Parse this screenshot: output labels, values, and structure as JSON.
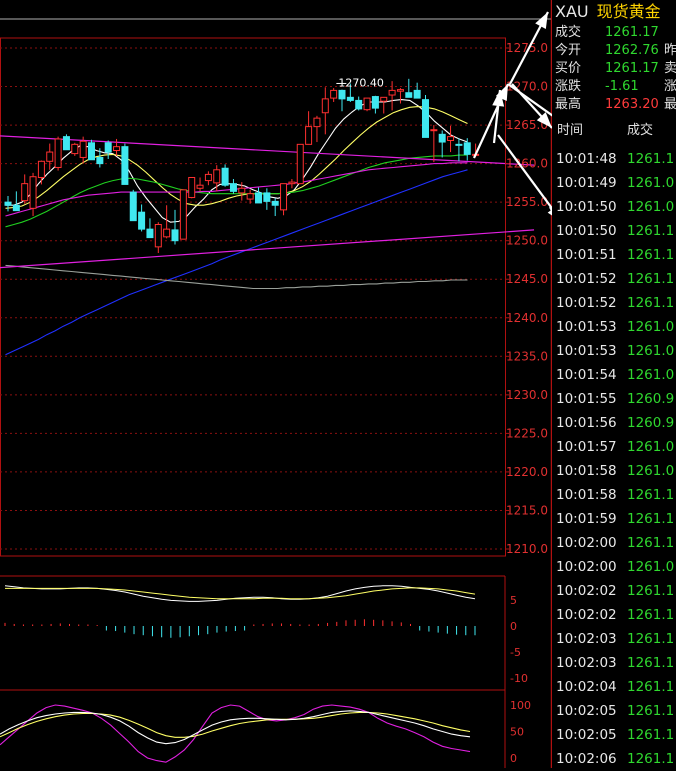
{
  "quote": {
    "symbol": "XAU",
    "name": "现货黄金",
    "rows": [
      {
        "label": "成交",
        "value": "1261.17",
        "color": "#2fd82f",
        "label2": ""
      },
      {
        "label": "今开",
        "value": "1262.76",
        "color": "#2fd82f",
        "label2": "昨"
      },
      {
        "label": "买价",
        "value": "1261.17",
        "color": "#2fd82f",
        "label2": "卖"
      },
      {
        "label": "涨跌",
        "value": "-1.61",
        "color": "#2fd82f",
        "label2": "涨"
      },
      {
        "label": "最高",
        "value": "1263.20",
        "color": "#ff3b3b",
        "label2": "最"
      }
    ]
  },
  "ticks": {
    "header_time": "时间",
    "header_price": "成交",
    "rows": [
      {
        "time": "10:01:48",
        "price": "1261.1"
      },
      {
        "time": "10:01:49",
        "price": "1261.0"
      },
      {
        "time": "10:01:50",
        "price": "1261.0"
      },
      {
        "time": "10:01:50",
        "price": "1261.1"
      },
      {
        "time": "10:01:51",
        "price": "1261.1"
      },
      {
        "time": "10:01:52",
        "price": "1261.1"
      },
      {
        "time": "10:01:52",
        "price": "1261.1"
      },
      {
        "time": "10:01:53",
        "price": "1261.0"
      },
      {
        "time": "10:01:53",
        "price": "1261.0"
      },
      {
        "time": "10:01:54",
        "price": "1261.0"
      },
      {
        "time": "10:01:55",
        "price": "1260.9"
      },
      {
        "time": "10:01:56",
        "price": "1260.9"
      },
      {
        "time": "10:01:57",
        "price": "1261.0"
      },
      {
        "time": "10:01:58",
        "price": "1261.0"
      },
      {
        "time": "10:01:58",
        "price": "1261.1"
      },
      {
        "time": "10:01:59",
        "price": "1261.1"
      },
      {
        "time": "10:02:00",
        "price": "1261.1"
      },
      {
        "time": "10:02:00",
        "price": "1261.0"
      },
      {
        "time": "10:02:02",
        "price": "1261.1"
      },
      {
        "time": "10:02:02",
        "price": "1261.1"
      },
      {
        "time": "10:02:03",
        "price": "1261.1"
      },
      {
        "time": "10:02:03",
        "price": "1261.1"
      },
      {
        "time": "10:02:04",
        "price": "1261.1"
      },
      {
        "time": "10:02:05",
        "price": "1261.1"
      },
      {
        "time": "10:02:05",
        "price": "1261.1"
      },
      {
        "time": "10:02:06",
        "price": "1261.1"
      }
    ]
  },
  "chart_data": {
    "type": "candlestick",
    "price_axis": {
      "ylim": [
        1209,
        1276
      ],
      "ticks": [
        "1275.0",
        "1270.0",
        "1265.0",
        "1260.0",
        "1255.0",
        "1250.0",
        "1245.0",
        "1240.0",
        "1235.0",
        "1230.0",
        "1225.0",
        "1220.0",
        "1215.0",
        "1210.0"
      ],
      "tick_values": [
        1275,
        1270,
        1265,
        1260,
        1255,
        1250,
        1245,
        1240,
        1235,
        1230,
        1225,
        1220,
        1215,
        1210
      ]
    },
    "annotation": {
      "label": "1270.40",
      "value": 1270.4
    },
    "candles": [
      [
        1255.0,
        1255.8,
        1253.8,
        1254.6
      ],
      [
        1254.6,
        1256.4,
        1253.9,
        1253.9
      ],
      [
        1255.2,
        1258.6,
        1254.8,
        1257.4
      ],
      [
        1254.2,
        1258.8,
        1253.2,
        1258.3
      ],
      [
        1258.2,
        1260.4,
        1257.3,
        1260.3
      ],
      [
        1260.3,
        1262.6,
        1259.2,
        1261.5
      ],
      [
        1259.5,
        1263.5,
        1259.1,
        1263.2
      ],
      [
        1263.5,
        1263.8,
        1261.8,
        1261.8
      ],
      [
        1261.3,
        1262.7,
        1261.0,
        1262.5
      ],
      [
        1260.8,
        1263.5,
        1260.0,
        1262.9
      ],
      [
        1262.7,
        1263.1,
        1260.5,
        1260.5
      ],
      [
        1260.8,
        1262.0,
        1259.5,
        1260.0
      ],
      [
        1262.7,
        1263.0,
        1260.6,
        1261.5
      ],
      [
        1261.7,
        1263.2,
        1261.0,
        1262.2
      ],
      [
        1262.2,
        1262.6,
        1257.3,
        1257.3
      ],
      [
        1256.3,
        1256.6,
        1252.6,
        1252.6
      ],
      [
        1253.7,
        1254.7,
        1251.2,
        1251.5
      ],
      [
        1251.5,
        1252.9,
        1250.4,
        1250.4
      ],
      [
        1249.2,
        1252.4,
        1248.4,
        1252.1
      ],
      [
        1250.5,
        1254.6,
        1250.3,
        1251.5
      ],
      [
        1251.4,
        1254.0,
        1249.5,
        1250.0
      ],
      [
        1250.2,
        1256.6,
        1250.3,
        1256.6
      ],
      [
        1255.6,
        1258.0,
        1255.5,
        1258.2
      ],
      [
        1256.8,
        1258.2,
        1256.4,
        1257.2
      ],
      [
        1257.8,
        1259.0,
        1257.2,
        1258.6
      ],
      [
        1257.5,
        1259.8,
        1256.4,
        1259.2
      ],
      [
        1259.4,
        1259.9,
        1257.0,
        1257.2
      ],
      [
        1257.4,
        1258.0,
        1256.1,
        1256.4
      ],
      [
        1256.2,
        1257.6,
        1255.2,
        1256.8
      ],
      [
        1255.4,
        1256.6,
        1254.8,
        1256.1
      ],
      [
        1256.2,
        1256.9,
        1254.9,
        1254.9
      ],
      [
        1256.2,
        1256.8,
        1254.0,
        1255.1
      ],
      [
        1255.1,
        1255.5,
        1253.2,
        1254.6
      ],
      [
        1254.0,
        1257.4,
        1253.3,
        1257.4
      ],
      [
        1257.4,
        1258.0,
        1256.8,
        1257.6
      ],
      [
        1257.4,
        1262.5,
        1257.5,
        1262.5
      ],
      [
        1262.5,
        1266.8,
        1263.0,
        1264.8
      ],
      [
        1264.8,
        1266.2,
        1262.8,
        1265.9
      ],
      [
        1266.6,
        1269.9,
        1263.8,
        1268.4
      ],
      [
        1268.5,
        1269.8,
        1268.0,
        1269.5
      ],
      [
        1269.5,
        1269.6,
        1266.8,
        1268.4
      ],
      [
        1268.6,
        1270.4,
        1268.0,
        1268.2
      ],
      [
        1268.2,
        1268.7,
        1266.9,
        1267.1
      ],
      [
        1267.0,
        1268.5,
        1266.8,
        1268.5
      ],
      [
        1268.7,
        1268.8,
        1266.5,
        1267.2
      ],
      [
        1268.1,
        1268.6,
        1266.5,
        1268.6
      ],
      [
        1268.9,
        1270.7,
        1266.9,
        1269.5
      ],
      [
        1269.4,
        1269.8,
        1267.8,
        1269.6
      ],
      [
        1269.2,
        1271.0,
        1268.8,
        1268.6
      ],
      [
        1269.5,
        1270.5,
        1268.5,
        1268.5
      ],
      [
        1268.3,
        1268.9,
        1263.4,
        1263.4
      ],
      [
        1264.3,
        1265.0,
        1260.2,
        1264.4
      ],
      [
        1263.8,
        1264.3,
        1260.8,
        1262.8
      ],
      [
        1263.0,
        1264.9,
        1261.5,
        1263.5
      ],
      [
        1262.5,
        1263.3,
        1260.3,
        1262.4
      ],
      [
        1262.7,
        1263.3,
        1260.4,
        1261.2
      ],
      [
        1261.2,
        1262.6,
        1260.9,
        1261.2
      ]
    ],
    "series": [
      {
        "name": "",
        "color": "#ffffff",
        "values": [
          1254.6,
          1254.6,
          1255.0,
          1256.0,
          1257.4,
          1258.6,
          1259.6,
          1260.7,
          1261.6,
          1262.3,
          1262.2,
          1261.7,
          1261.4,
          1261.3,
          1260.5,
          1259.0,
          1257.1,
          1255.6,
          1254.3,
          1253.0,
          1252.4,
          1252.5,
          1253.2,
          1254.4,
          1255.4,
          1256.6,
          1257.3,
          1257.4,
          1257.3,
          1257.1,
          1256.6,
          1256.2,
          1255.7,
          1255.5,
          1255.8,
          1256.6,
          1258.0,
          1259.6,
          1261.4,
          1263.0,
          1264.6,
          1265.8,
          1266.7,
          1267.5,
          1268.0,
          1268.0,
          1268.0,
          1268.2,
          1268.3,
          1268.2,
          1267.5,
          1266.6,
          1265.5,
          1264.6,
          1263.7,
          1263.2,
          1262.8
        ]
      },
      {
        "name": "",
        "color": "#ffff66",
        "values": [
          1254.2,
          1254.3,
          1254.5,
          1255.0,
          1255.7,
          1256.5,
          1257.4,
          1258.3,
          1259.1,
          1259.9,
          1260.5,
          1260.9,
          1261.1,
          1261.2,
          1261.0,
          1260.5,
          1259.8,
          1258.9,
          1257.9,
          1256.9,
          1256.0,
          1255.3,
          1254.8,
          1254.6,
          1254.6,
          1254.8,
          1255.1,
          1255.5,
          1255.8,
          1256.0,
          1256.1,
          1256.1,
          1256.1,
          1256.1,
          1256.2,
          1256.5,
          1257.0,
          1257.7,
          1258.6,
          1259.6,
          1260.6,
          1261.7,
          1262.7,
          1263.7,
          1264.6,
          1265.4,
          1266.0,
          1266.6,
          1267.0,
          1267.3,
          1267.4,
          1267.3,
          1267.1,
          1266.7,
          1266.2,
          1265.7,
          1265.2
        ]
      },
      {
        "name": "",
        "color": "#20d020",
        "values": [
          1251.8,
          1252.1,
          1252.4,
          1252.8,
          1253.3,
          1253.8,
          1254.4,
          1255.0,
          1255.6,
          1256.2,
          1256.7,
          1257.1,
          1257.5,
          1257.8,
          1258.0,
          1258.1,
          1258.0,
          1257.8,
          1257.6,
          1257.3,
          1257.0,
          1256.7,
          1256.5,
          1256.3,
          1256.2,
          1256.1,
          1256.1,
          1256.1,
          1256.1,
          1256.1,
          1256.1,
          1256.1,
          1256.1,
          1256.1,
          1256.2,
          1256.3,
          1256.5,
          1256.8,
          1257.1,
          1257.5,
          1257.9,
          1258.3,
          1258.7,
          1259.1,
          1259.5,
          1259.8,
          1260.1,
          1260.3,
          1260.5,
          1260.7,
          1260.8,
          1260.9,
          1261.0,
          1261.0,
          1261.0,
          1261.1,
          1261.1
        ]
      },
      {
        "name": "",
        "color": "#e020e0",
        "values": [
          1253.2,
          1253.5,
          1253.8,
          1254.1,
          1254.4,
          1254.7,
          1255.0,
          1255.3,
          1255.5,
          1255.7,
          1255.9,
          1256.0,
          1256.1,
          1256.2,
          1256.3,
          1256.3,
          1256.3,
          1256.3,
          1256.3,
          1256.3,
          1256.3,
          1256.3,
          1256.3,
          1256.3,
          1256.4,
          1256.4,
          1256.5,
          1256.6,
          1256.7,
          1256.8,
          1256.9,
          1257.0,
          1257.1,
          1257.2,
          1257.3,
          1257.5,
          1257.6,
          1257.8,
          1258.0,
          1258.2,
          1258.4,
          1258.6,
          1258.8,
          1259.0,
          1259.2,
          1259.3,
          1259.4,
          1259.5,
          1259.6,
          1259.7,
          1259.8,
          1259.9,
          1260.0,
          1260.0,
          1260.1,
          1260.1,
          1260.1
        ]
      },
      {
        "name": "",
        "color": "#2030ff",
        "values": [
          1235.2,
          1235.7,
          1236.2,
          1236.7,
          1237.2,
          1237.8,
          1238.3,
          1238.9,
          1239.4,
          1240.0,
          1240.5,
          1241.0,
          1241.5,
          1242.0,
          1242.5,
          1243.0,
          1243.4,
          1243.8,
          1244.2,
          1244.6,
          1245.0,
          1245.4,
          1245.8,
          1246.2,
          1246.6,
          1247.0,
          1247.5,
          1247.9,
          1248.3,
          1248.7,
          1249.1,
          1249.5,
          1249.9,
          1250.3,
          1250.7,
          1251.1,
          1251.5,
          1251.9,
          1252.3,
          1252.7,
          1253.1,
          1253.5,
          1253.9,
          1254.3,
          1254.7,
          1255.1,
          1255.5,
          1255.9,
          1256.3,
          1256.7,
          1257.1,
          1257.5,
          1257.9,
          1258.3,
          1258.6,
          1258.9,
          1259.2
        ]
      },
      {
        "name": "",
        "color": "#9aa09a",
        "values": [
          1246.8,
          1246.7,
          1246.6,
          1246.5,
          1246.4,
          1246.3,
          1246.2,
          1246.1,
          1246.0,
          1245.9,
          1245.8,
          1245.7,
          1245.6,
          1245.5,
          1245.4,
          1245.3,
          1245.2,
          1245.1,
          1245.0,
          1244.9,
          1244.8,
          1244.7,
          1244.6,
          1244.5,
          1244.4,
          1244.3,
          1244.2,
          1244.1,
          1244.0,
          1243.9,
          1243.8,
          1243.8,
          1243.8,
          1243.8,
          1243.9,
          1243.9,
          1244.0,
          1244.0,
          1244.1,
          1244.1,
          1244.2,
          1244.2,
          1244.3,
          1244.3,
          1244.4,
          1244.4,
          1244.5,
          1244.5,
          1244.6,
          1244.6,
          1244.7,
          1244.7,
          1244.8,
          1244.8,
          1244.9,
          1244.9,
          1244.9
        ]
      }
    ],
    "trendlines": [
      {
        "color": "#e020e0",
        "from": [
          -1,
          1263.6
        ],
        "to": [
          63,
          1259.8
        ]
      },
      {
        "color": "#e020e0",
        "from": [
          -1,
          1246.5
        ],
        "to": [
          63,
          1251.4
        ]
      }
    ],
    "macd": {
      "ylim": [
        -7,
        8
      ],
      "ticks": [
        "5",
        "0",
        "-5"
      ],
      "tick_values": [
        5,
        0,
        -5
      ],
      "dif": [
        3.5,
        3.3,
        3.1,
        3.0,
        2.9,
        2.9,
        2.9,
        3.0,
        3.1,
        3.1,
        3.0,
        2.8,
        2.6,
        2.3,
        1.9,
        1.5,
        1.2,
        0.9,
        0.7,
        0.6,
        0.5,
        0.5,
        0.6,
        0.7,
        0.9,
        1.1,
        1.2,
        1.3,
        1.3,
        1.2,
        1.0,
        0.9,
        0.9,
        1.0,
        1.2,
        1.5,
        2.0,
        2.5,
        2.9,
        3.2,
        3.4,
        3.5,
        3.5,
        3.4,
        3.2,
        3.0,
        2.8,
        2.5,
        2.1,
        1.7,
        1.3,
        1.0
      ],
      "dea": [
        3.0,
        3.0,
        3.0,
        3.0,
        3.0,
        3.0,
        3.0,
        3.0,
        3.0,
        3.0,
        3.0,
        2.9,
        2.8,
        2.7,
        2.5,
        2.3,
        2.1,
        1.9,
        1.7,
        1.5,
        1.3,
        1.2,
        1.1,
        1.0,
        1.0,
        1.0,
        1.0,
        1.0,
        1.1,
        1.1,
        1.1,
        1.0,
        1.0,
        1.0,
        1.1,
        1.2,
        1.4,
        1.6,
        1.9,
        2.2,
        2.5,
        2.7,
        2.9,
        3.0,
        3.1,
        3.1,
        3.0,
        2.9,
        2.7,
        2.5,
        2.2,
        1.9
      ],
      "hist": [
        0.4,
        0.2,
        0.1,
        0.1,
        0.1,
        0.2,
        0.3,
        0.2,
        0.1,
        0.1,
        0.0,
        -0.1,
        -0.2,
        -0.5,
        -0.8,
        -1.0,
        -1.2,
        -1.4,
        -1.5,
        -1.4,
        -1.2,
        -1.0,
        -0.8,
        -0.5,
        -0.3,
        -0.2,
        -0.1,
        0.1,
        0.2,
        0.3,
        0.3,
        0.2,
        0.1,
        0.1,
        0.2,
        0.4,
        0.6,
        0.9,
        1.0,
        1.1,
        1.0,
        0.9,
        0.7,
        0.5,
        0.2,
        -0.1,
        -0.3,
        -0.5,
        -0.7,
        -0.9,
        -1.0,
        -1.0
      ]
    },
    "kdj": {
      "ylim": [
        -10,
        110
      ],
      "ticks": [
        "-10",
        "100",
        "50",
        "0"
      ],
      "tick_values": [
        -10,
        100,
        50,
        0
      ],
      "k": [
        45,
        55,
        63,
        70,
        76,
        80,
        83,
        85,
        86,
        86,
        85,
        82,
        77,
        70,
        60,
        48,
        38,
        30,
        27,
        29,
        35,
        44,
        53,
        62,
        68,
        72,
        74,
        75,
        75,
        74,
        73,
        72,
        73,
        75,
        78,
        82,
        86,
        88,
        89,
        88,
        86,
        82,
        78,
        74,
        70,
        66,
        61,
        55,
        50,
        45,
        42,
        40
      ],
      "d": [
        40,
        48,
        56,
        63,
        69,
        74,
        78,
        81,
        83,
        84,
        84,
        83,
        81,
        77,
        71,
        64,
        56,
        48,
        42,
        39,
        39,
        41,
        45,
        51,
        56,
        61,
        65,
        68,
        70,
        72,
        73,
        73,
        73,
        74,
        75,
        77,
        80,
        83,
        85,
        86,
        86,
        85,
        83,
        80,
        77,
        74,
        70,
        66,
        61,
        57,
        53,
        50
      ],
      "j": [
        25,
        40,
        55,
        70,
        85,
        95,
        100,
        98,
        94,
        90,
        85,
        75,
        62,
        46,
        30,
        12,
        0,
        -5,
        -8,
        2,
        15,
        35,
        60,
        85,
        95,
        100,
        98,
        88,
        78,
        72,
        70,
        72,
        76,
        82,
        92,
        98,
        100,
        98,
        96,
        92,
        86,
        75,
        66,
        60,
        55,
        48,
        40,
        30,
        22,
        18,
        15,
        12
      ]
    }
  }
}
